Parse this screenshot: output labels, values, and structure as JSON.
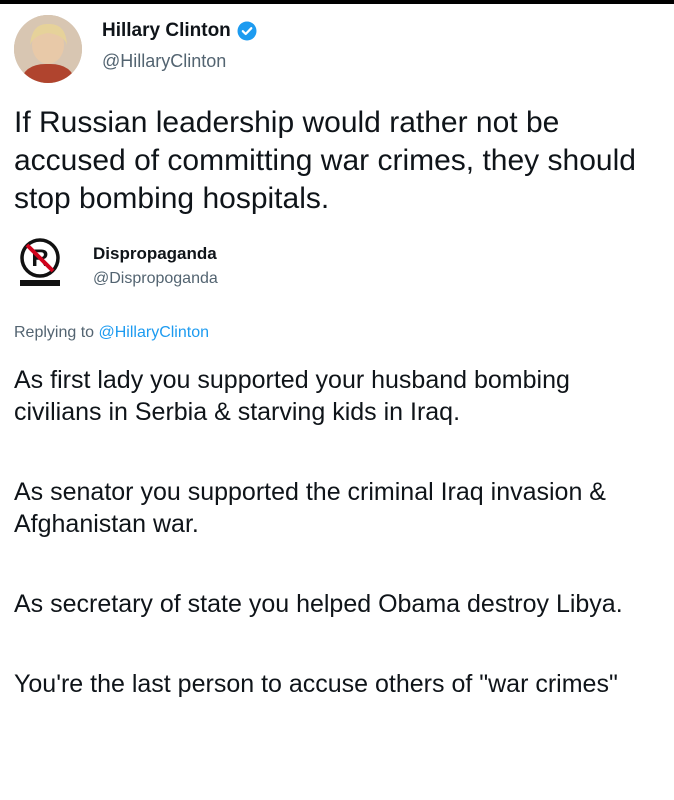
{
  "original_tweet": {
    "author_name": "Hillary Clinton",
    "author_handle": "@HillaryClinton",
    "verified": true,
    "text": "If Russian leadership would rather not be accused of committing war crimes, they should stop bombing hospitals.",
    "avatar_icon": "person-photo-avatar"
  },
  "reply_tweet": {
    "author_name": "Dispropaganda",
    "author_handle": "@Dispropoganda",
    "avatar_icon": "no-propaganda-logo",
    "replying_prefix": "Replying to",
    "replying_to": "@HillaryClinton",
    "paragraphs": [
      "As first lady you supported your husband bombing civilians in Serbia & starving kids in Iraq.",
      "As senator you supported the criminal Iraq invasion & Afghanistan war.",
      "As secretary of state you helped Obama destroy Libya.",
      "You're the last person to accuse others of \"war crimes\""
    ]
  },
  "colors": {
    "text": "#0f1419",
    "secondary": "#536471",
    "accent": "#1d9bf0"
  }
}
